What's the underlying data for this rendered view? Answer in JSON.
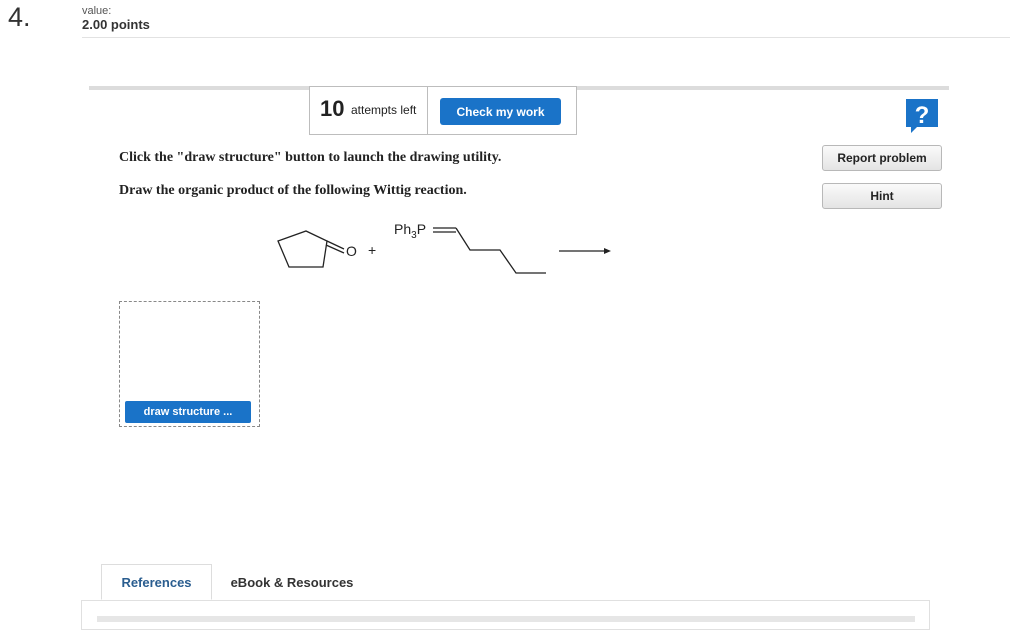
{
  "question": {
    "number": "4.",
    "value_label": "value:",
    "points": "2.00 points"
  },
  "attempts": {
    "count": "10",
    "label": "attempts left",
    "check_label": "Check my work"
  },
  "side_buttons": {
    "help_icon": "question-icon",
    "help_glyph": "?",
    "report_label": "Report problem",
    "hint_label": "Hint"
  },
  "instructions": {
    "line1": "Click the \"draw structure\" button to launch the drawing utility.",
    "line2": "Draw the organic product of the following Wittig reaction."
  },
  "reaction": {
    "carbonyl_o": "O",
    "plus": "+",
    "ylide_ph": "Ph",
    "ylide_sub": "3",
    "ylide_p": "P"
  },
  "draw_tool": {
    "button_label": "draw structure ..."
  },
  "tabs": [
    {
      "label": "References",
      "active": true
    },
    {
      "label": "eBook & Resources",
      "active": false
    }
  ],
  "colors": {
    "accent": "#1a73c8",
    "tab_active_text": "#2a5d8f"
  }
}
